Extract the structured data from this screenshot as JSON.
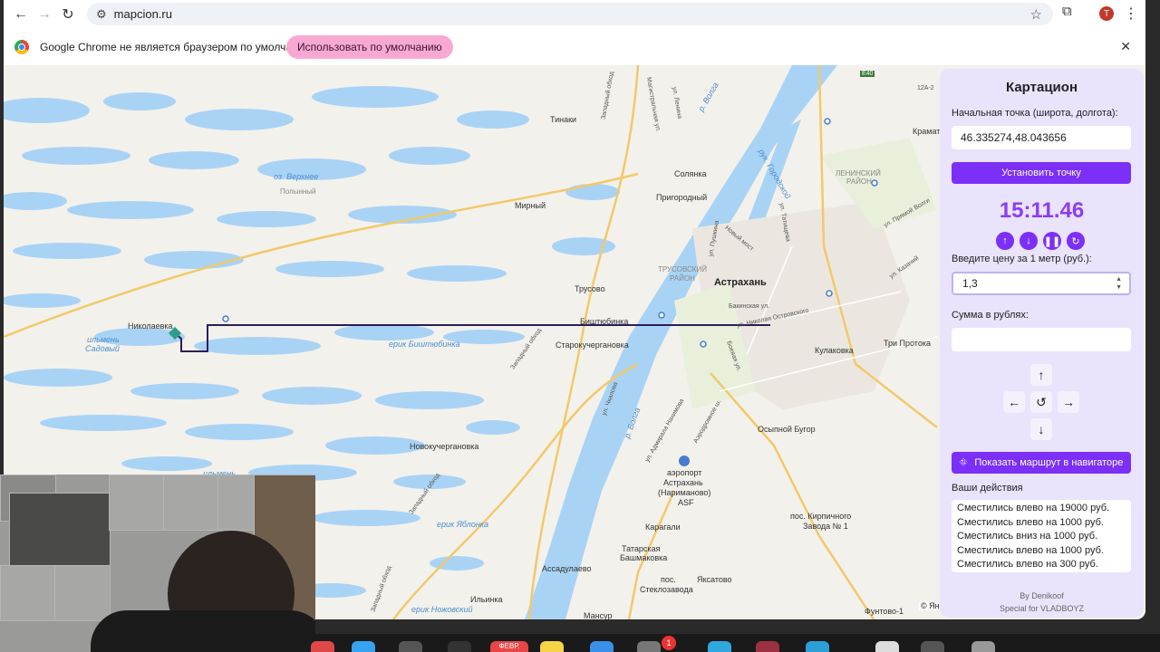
{
  "browser": {
    "url": "mapcion.ru",
    "profile_initial": "T",
    "infobar_text": "Google Chrome не является браузером по умолчанию.",
    "infobar_button": "Использовать по умолчанию"
  },
  "map": {
    "labels": {
      "tinaki": "Тинаки",
      "solyanka": "Солянка",
      "verhnee": "оз. Верхнее",
      "polny": "Полынный",
      "prigorodny": "Пригородный",
      "mirny": "Мирный",
      "leninsky": "ЛЕНИНСКИЙ",
      "rayon1": "РАЙОН",
      "trusovsky": "ТРУСОВСКИЙ",
      "rayon2": "РАЙОН",
      "trusovo": "Трусово",
      "astrakhan": "Астрахань",
      "nikolaevka": "Николаевка",
      "ilmen_sadovy1": "ильмень",
      "ilmen_sadovy2": "Садовый",
      "bishtyubinka": "Биштюбинка",
      "erik_bishtyubinka": "ерик Биштюбинка",
      "starokucherganovka": "Старокучергановка",
      "kulakovka": "Кулаковка",
      "tri_protoka": "Три Протока",
      "osypnoy_bugor": "Осыпной Бугор",
      "novokucherganovka": "Новокучергановка",
      "airport1": "аэропорт",
      "airport2": "Астрахань",
      "airport3": "(Нариманово)",
      "airport4": "ASF",
      "kirpichnogo1": "пос. Кирпичного",
      "kirpichnogo2": "Завода № 1",
      "karagali": "Карагали",
      "tatarskaya1": "Татарская",
      "tatarskaya2": "Башмаковка",
      "assadulaevo": "Ассадулаево",
      "yaksatovo": "Яксатово",
      "steklozavoda1": "пос.",
      "steklozavoda2": "Стеклозавода",
      "ilinka": "Ильинка",
      "funtovo": "Фунтово-1",
      "mansur": "Мансур",
      "erik_yablonka": "ерик Яблонка",
      "erik_nozhovsky": "ерик Ножовский",
      "ilmen": "ильмень",
      "volga": "р. Волга",
      "volga2": "р. Волга",
      "gorodskoy": "рук. Городской",
      "zapadny1": "Западный обход",
      "zapadny2": "Западный обход",
      "zapadny3": "Западный обход",
      "zapadny4": "Западный обход",
      "magistralnaya": "Магистральная ул.",
      "lenina": "ул. Ленина",
      "novy_most": "Новый мост",
      "bakinskaya": "Бакинская ул.",
      "nikolaya": "ул. Николая Островского",
      "boevaya": "Боевая ул.",
      "chkalova": "ул. Чкалова",
      "admirala": "ул. Адмирала Нахимова",
      "aerodromnaya": "Аэродромное ш.",
      "e40": "E40",
      "r12": "12А-2",
      "kramat": "Крамат",
      "primaya": "ул. Прямой Волги",
      "kazachiy": "ул. Казачий",
      "tatishcheva": "ул. Татищева",
      "pushkina": "ул. Пушкина"
    },
    "copyright": "© Ян"
  },
  "panel": {
    "title": "Картацион",
    "start_label": "Начальная точка (широта, долгота):",
    "start_value": "46.335274,48.043656",
    "set_button": "Установить точку",
    "timer": "15:11.46",
    "price_label": "Введите цену за 1 метр (руб.):",
    "price_value": "1,3",
    "sum_label": "Сумма в рублях:",
    "sum_value": "",
    "route_button": "Показать маршрут в навигаторе",
    "actions_label": "Ваши действия",
    "actions": [
      "Сместились влево на 19000 руб.",
      "Сместились влево на 1000 руб.",
      "Сместились вниз на 1000 руб.",
      "Сместились влево на 1000 руб.",
      "Сместились влево на 300 руб."
    ],
    "credit": "By Denikoof",
    "special": "Special for VLADBOYZ"
  },
  "dock": {
    "calendar_label": "ФЕВР.",
    "badge_count": "1"
  }
}
